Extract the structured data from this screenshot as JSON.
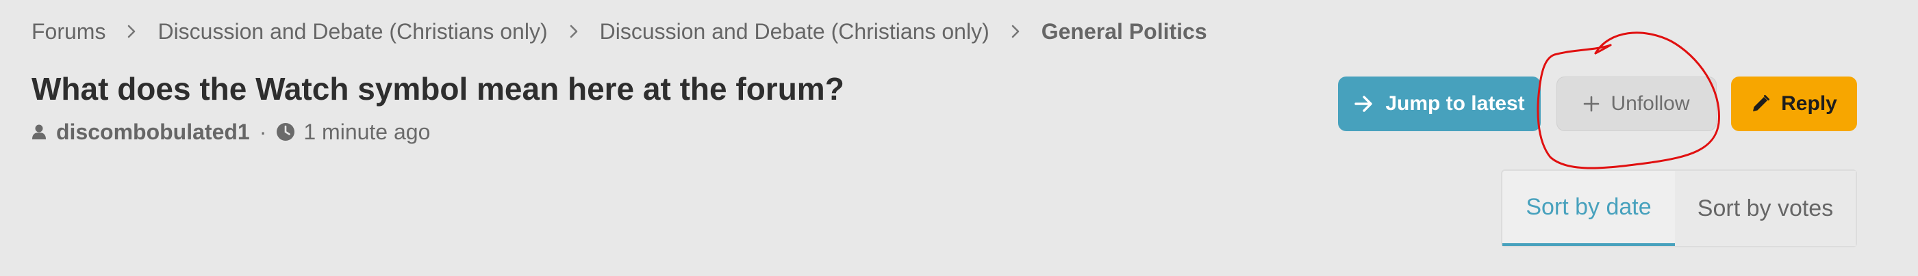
{
  "breadcrumb": {
    "items": [
      {
        "label": "Forums"
      },
      {
        "label": "Discussion and Debate (Christians only)"
      },
      {
        "label": "Discussion and Debate (Christians only)"
      },
      {
        "label": "General Politics"
      }
    ]
  },
  "thread": {
    "title": "What does the Watch symbol mean here at the forum?",
    "author": "discombobulated1",
    "separator": "·",
    "time": "1 minute ago",
    "author_icon": "user-icon",
    "time_icon": "clock-icon"
  },
  "actions": {
    "jump_label": "Jump to latest",
    "jump_icon": "arrow-right-icon",
    "unfollow_label": "Unfollow",
    "unfollow_icon": "plus-icon",
    "reply_label": "Reply",
    "reply_icon": "pencil-icon"
  },
  "sort": {
    "date_label": "Sort by date",
    "votes_label": "Sort by votes",
    "active": "date"
  },
  "colors": {
    "background": "#e8e8e8",
    "accent": "#47a1bd",
    "reply": "#f7a600",
    "annotation": "#e01010"
  }
}
